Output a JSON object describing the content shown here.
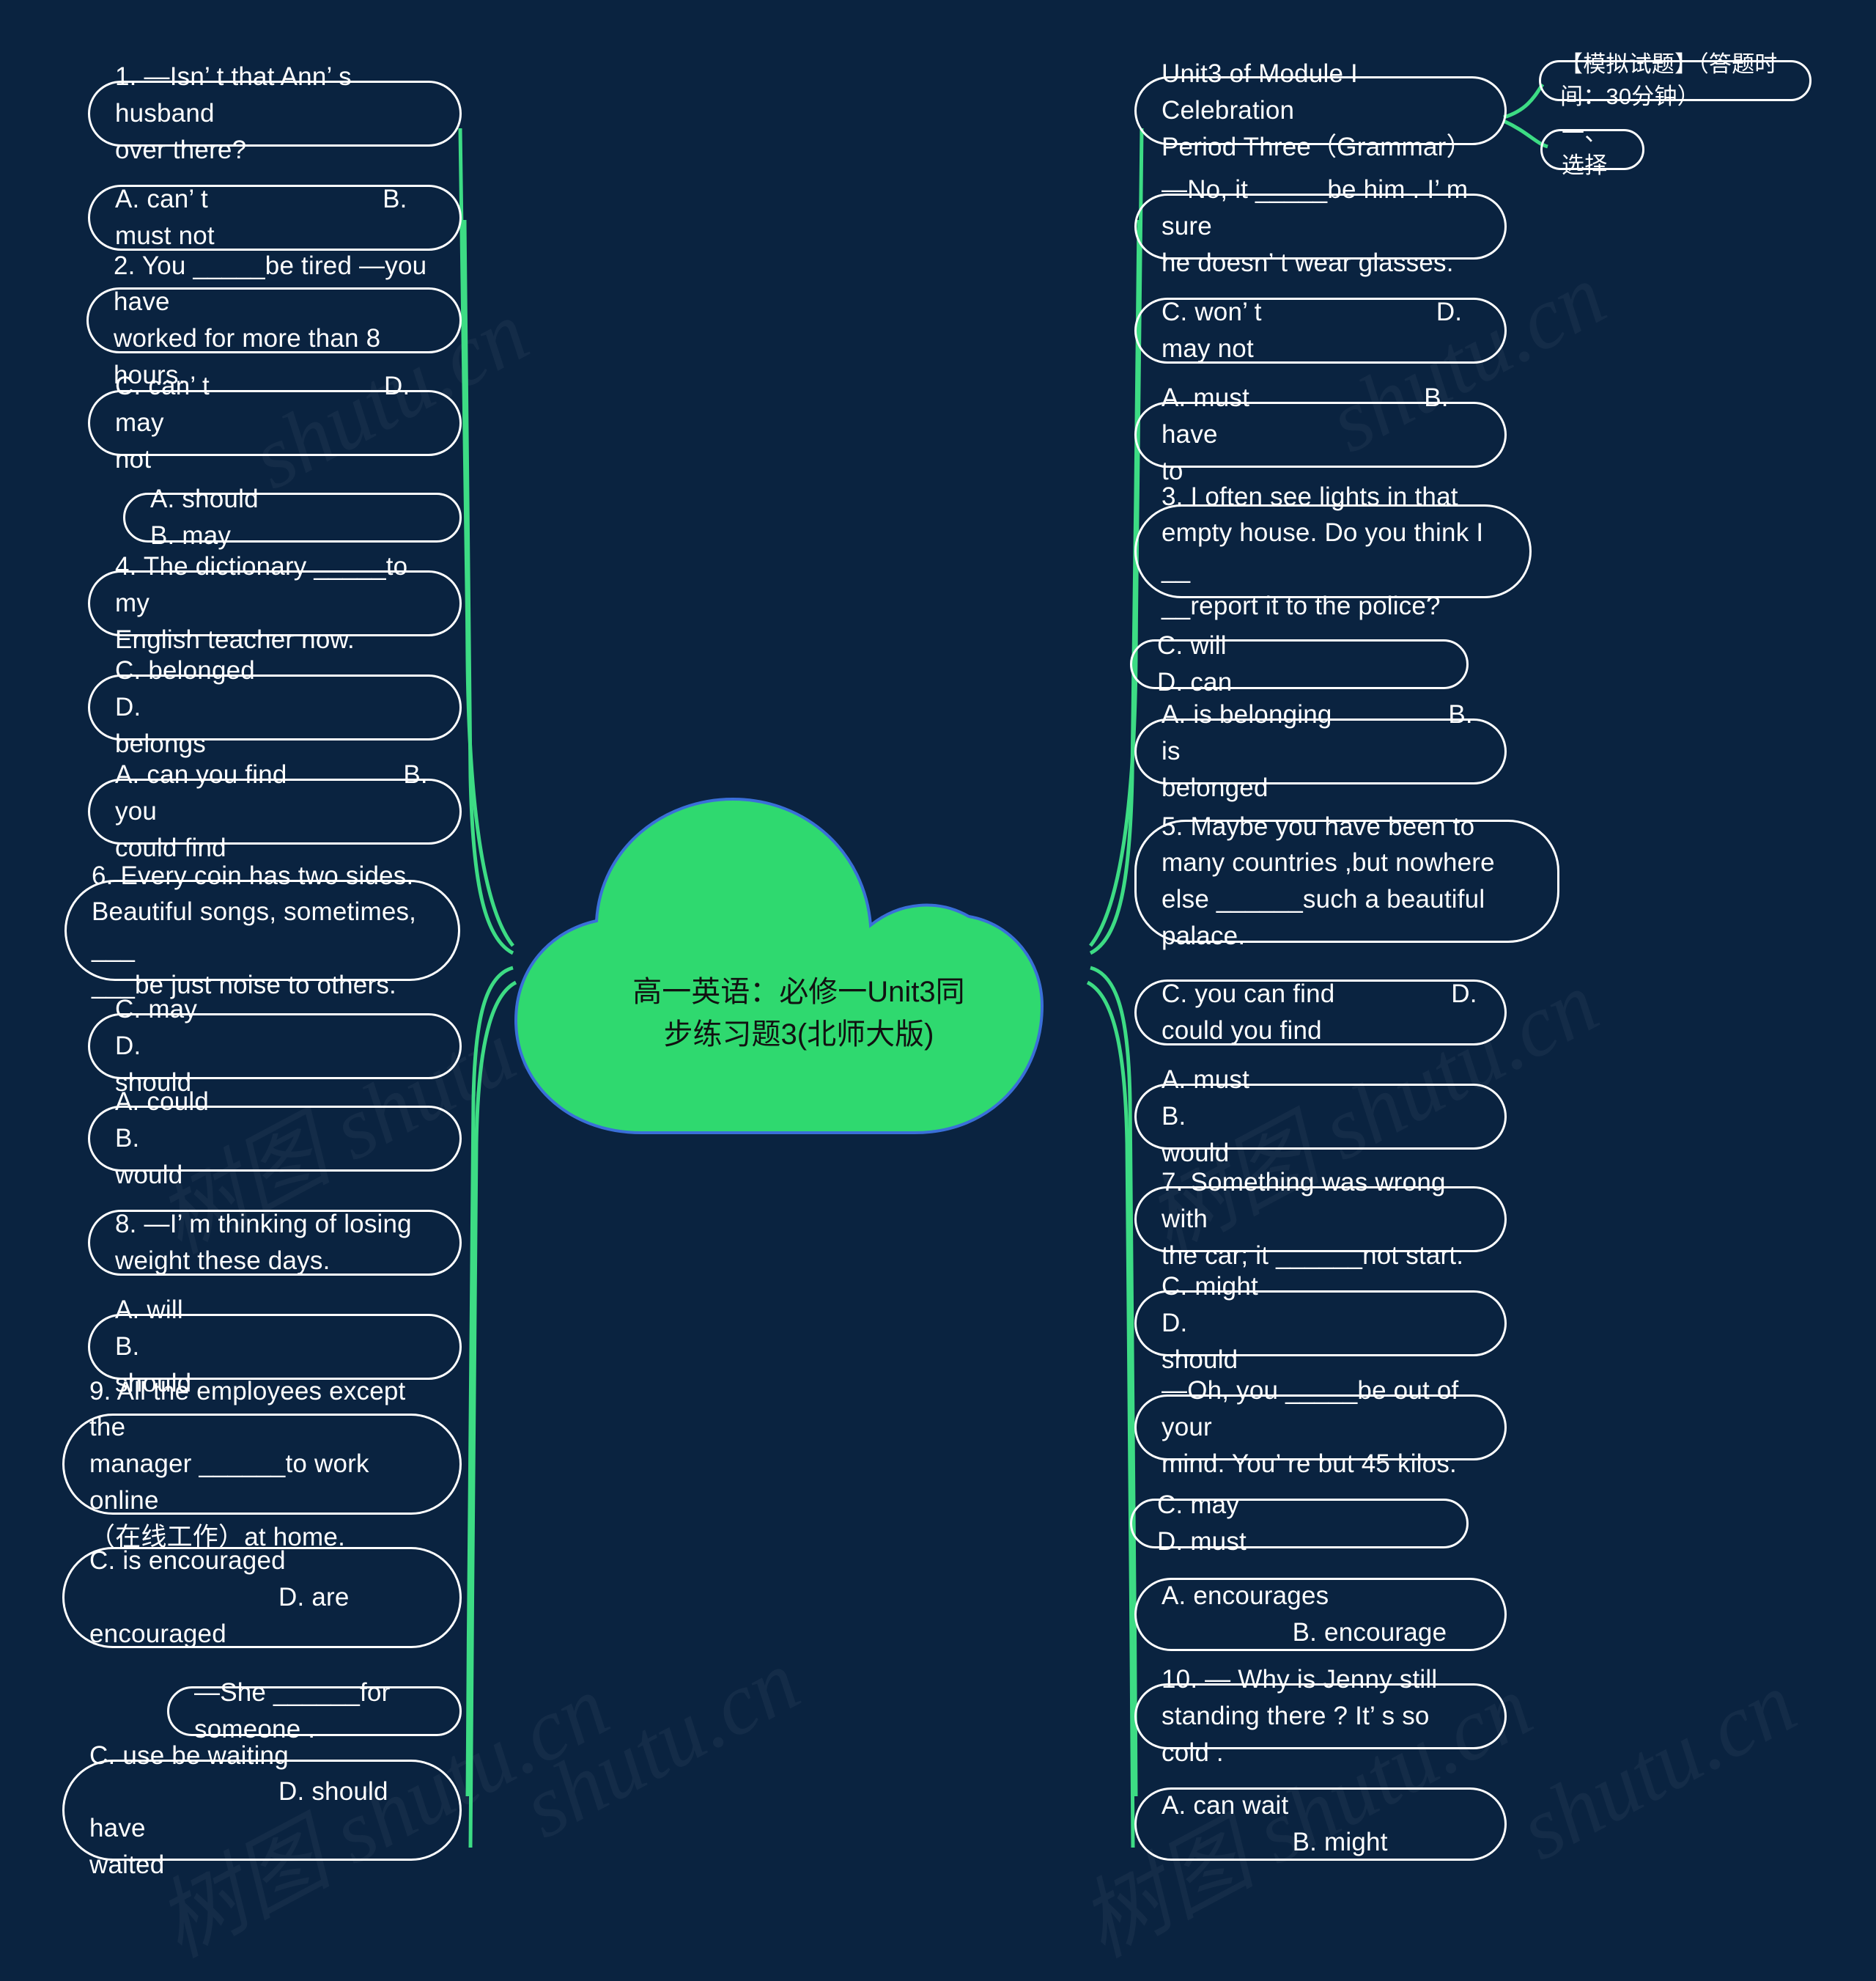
{
  "theme": {
    "background": "#0a2340",
    "node_border": "#ffffff",
    "node_text": "#ffffff",
    "branch_line": "#3ddc84",
    "center_fill": "#2fd96f",
    "center_text": "#111111"
  },
  "center": {
    "title": "高一英语：必修一Unit3同\n步练习题3(北师大版)",
    "shape": "cloud"
  },
  "watermarks": [
    "树图 shutu.cn",
    "shutu.cn",
    "树图 shutu.cn",
    "shutu.cn",
    "树图 shutu.cn",
    "shutu.cn",
    "树图 shutu.cn",
    "shutu.cn"
  ],
  "left_branch": {
    "nodes": [
      {
        "id": "l1",
        "text": "1. —Isn’ t that Ann’ s husband\nover there?"
      },
      {
        "id": "l2",
        "text": "A. can’ t                        B.\nmust not"
      },
      {
        "id": "l3",
        "text": "2. You _____be tired —you have\nworked for more than 8 hours."
      },
      {
        "id": "l4",
        "text": "C. can’ t                        D. may\nnot"
      },
      {
        "id": "l5",
        "text": "A. should                        B. may"
      },
      {
        "id": "l6",
        "text": "4. The dictionary _____to my\nEnglish teacher now."
      },
      {
        "id": "l7",
        "text": "C. belonged                        D.\nbelongs"
      },
      {
        "id": "l8",
        "text": "A. can you find                B. you\ncould find"
      },
      {
        "id": "l9",
        "text": "6. Every coin has two sides.\nBeautiful songs, sometimes, ___\n___be just noise to others."
      },
      {
        "id": "l10",
        "text": "C. may                                D.\nshould"
      },
      {
        "id": "l11",
        "text": "A. could                                B.\nwould"
      },
      {
        "id": "l12",
        "text": "8. —I’ m thinking of losing\nweight these days."
      },
      {
        "id": "l13",
        "text": "A. will                                B.\nshould"
      },
      {
        "id": "l14",
        "text": "9. All the employees except the\nmanager ______to work online\n（在线工作）at home."
      },
      {
        "id": "l15",
        "text": "C. is encouraged\n                          D. are\nencouraged"
      },
      {
        "id": "l16",
        "text": "—She ______for someone ."
      },
      {
        "id": "l17",
        "text": "C. use be waiting\n                          D. should have\nwaited"
      }
    ]
  },
  "right_branch": {
    "nodes": [
      {
        "id": "r1",
        "text": "Unit3 of Module I Celebration\nPeriod Three（Grammar）"
      },
      {
        "id": "r2",
        "text": "—No, it _____be him . I’ m sure\nhe doesn’ t wear glasses."
      },
      {
        "id": "r3",
        "text": "C. won’ t                        D.\nmay not"
      },
      {
        "id": "r4",
        "text": "A. must                        B. have\nto"
      },
      {
        "id": "r5",
        "text": "3. I often see lights in that\nempty house. Do you think I __\n__report it to the police?"
      },
      {
        "id": "r6",
        "text": "C. will                                D. can"
      },
      {
        "id": "r7",
        "text": "A. is belonging                B. is\nbelonged"
      },
      {
        "id": "r8",
        "text": "5. Maybe you have been to\nmany countries ,but nowhere\nelse ______such a beautiful\npalace."
      },
      {
        "id": "r9",
        "text": "C. you can find                D.\ncould you find"
      },
      {
        "id": "r10",
        "text": "A. must                                B.\nwould"
      },
      {
        "id": "r11",
        "text": "7. Something was wrong with\nthe car; it ______not start."
      },
      {
        "id": "r12",
        "text": "C. might                                D.\nshould"
      },
      {
        "id": "r13",
        "text": "—Oh, you _____be out of your\nmind. You’ re but 45 kilos."
      },
      {
        "id": "r14",
        "text": "C. may                                D. must"
      },
      {
        "id": "r15",
        "text": "A. encourages\n                  B. encourage"
      },
      {
        "id": "r16",
        "text": "10. — Why is Jenny still\nstanding there ? It’ s so cold ."
      },
      {
        "id": "r17",
        "text": "A. can wait\n                  B. might"
      }
    ]
  },
  "header_branch": {
    "nodes": [
      {
        "id": "h1",
        "text": "【模拟试题】（答题时间：30分钟）"
      },
      {
        "id": "h2",
        "text": "一、选择"
      }
    ]
  }
}
